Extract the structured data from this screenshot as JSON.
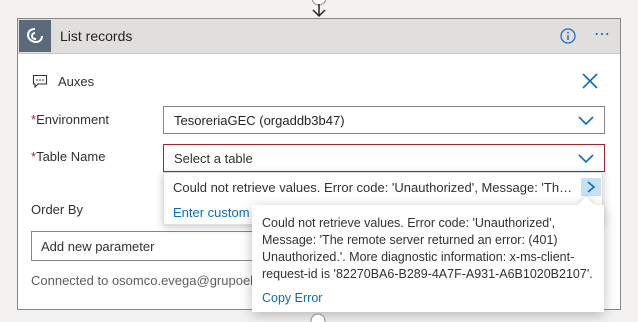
{
  "card": {
    "title": "List records",
    "comment": "Auxes"
  },
  "fields": {
    "environment": {
      "label": "Environment",
      "required": "*",
      "value": "TesoreriaGEC (orgaddb3b47)"
    },
    "table_name": {
      "label": "Table Name",
      "required": "*",
      "placeholder": "Select a table"
    },
    "order_by": {
      "label": "Order By"
    },
    "add_parameter": {
      "placeholder": "Add new parameter"
    }
  },
  "dropdown": {
    "error_option": "Could not retrieve values. Error code: 'Unauthorized', Message: 'The remote server returned an error: (401) Unauthorized.'",
    "custom_value": "Enter custom value"
  },
  "tooltip": {
    "message": "Could not retrieve values. Error code: 'Unauthorized', Message: 'The remote server returned an error: (401) Unauthorized.'. More diagnostic information: x-ms-client-request-id is '82270BA6-B289-4A7F-A931-A6B1020B2107'.",
    "copy_label": "Copy Error"
  },
  "connection": {
    "text": "Connected to osomco.evega@grupoelche"
  },
  "colors": {
    "accent": "#0f6cbd",
    "error": "#a4262c",
    "header_bg": "#e1dfdd"
  },
  "icons": [
    "dataverse-logo",
    "info-icon",
    "more-icon",
    "comment-icon",
    "close-icon",
    "chevron-down-icon",
    "chevron-right-icon"
  ]
}
